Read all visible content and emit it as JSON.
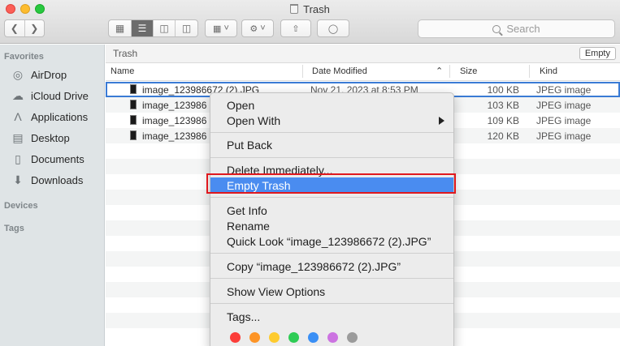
{
  "window": {
    "title": "Trash"
  },
  "toolbar": {
    "view_icons": [
      "icon-view-icon",
      "list-view-icon",
      "column-view-icon",
      "gallery-view-icon"
    ],
    "search_placeholder": "Search"
  },
  "sidebar": {
    "favorites_label": "Favorites",
    "items": [
      {
        "label": "AirDrop",
        "icon": "airdrop-icon"
      },
      {
        "label": "iCloud Drive",
        "icon": "cloud-icon"
      },
      {
        "label": "Applications",
        "icon": "applications-icon"
      },
      {
        "label": "Desktop",
        "icon": "desktop-icon"
      },
      {
        "label": "Documents",
        "icon": "document-icon"
      },
      {
        "label": "Downloads",
        "icon": "download-icon"
      }
    ],
    "devices_label": "Devices",
    "tags_label": "Tags"
  },
  "pathbar": {
    "location": "Trash",
    "empty_label": "Empty"
  },
  "columns": {
    "name": "Name",
    "date": "Date Modified",
    "size": "Size",
    "kind": "Kind"
  },
  "files": [
    {
      "name": "image_123986672 (2).JPG",
      "date": "Nov 21, 2023 at 8:53 PM",
      "size": "100 KB",
      "kind": "JPEG image"
    },
    {
      "name": "image_123986",
      "date": "",
      "size": "103 KB",
      "kind": "JPEG image"
    },
    {
      "name": "image_123986",
      "date": "",
      "size": "109 KB",
      "kind": "JPEG image"
    },
    {
      "name": "image_123986",
      "date": "",
      "size": "120 KB",
      "kind": "JPEG image"
    }
  ],
  "context_menu": {
    "open": "Open",
    "open_with": "Open With",
    "put_back": "Put Back",
    "delete_immediately": "Delete Immediately...",
    "empty_trash": "Empty Trash",
    "get_info": "Get Info",
    "rename": "Rename",
    "quick_look": "Quick Look “image_123986672 (2).JPG”",
    "copy": "Copy “image_123986672 (2).JPG”",
    "show_view_options": "Show View Options",
    "tags": "Tags...",
    "tag_colors": [
      "#fc3d39",
      "#fd9426",
      "#fecb2e",
      "#2ecc55",
      "#3a8ff5",
      "#cc73e1",
      "#9b9b9b"
    ]
  },
  "colors": {
    "highlight": "#4a8cf0",
    "annotation": "#e0181e"
  }
}
